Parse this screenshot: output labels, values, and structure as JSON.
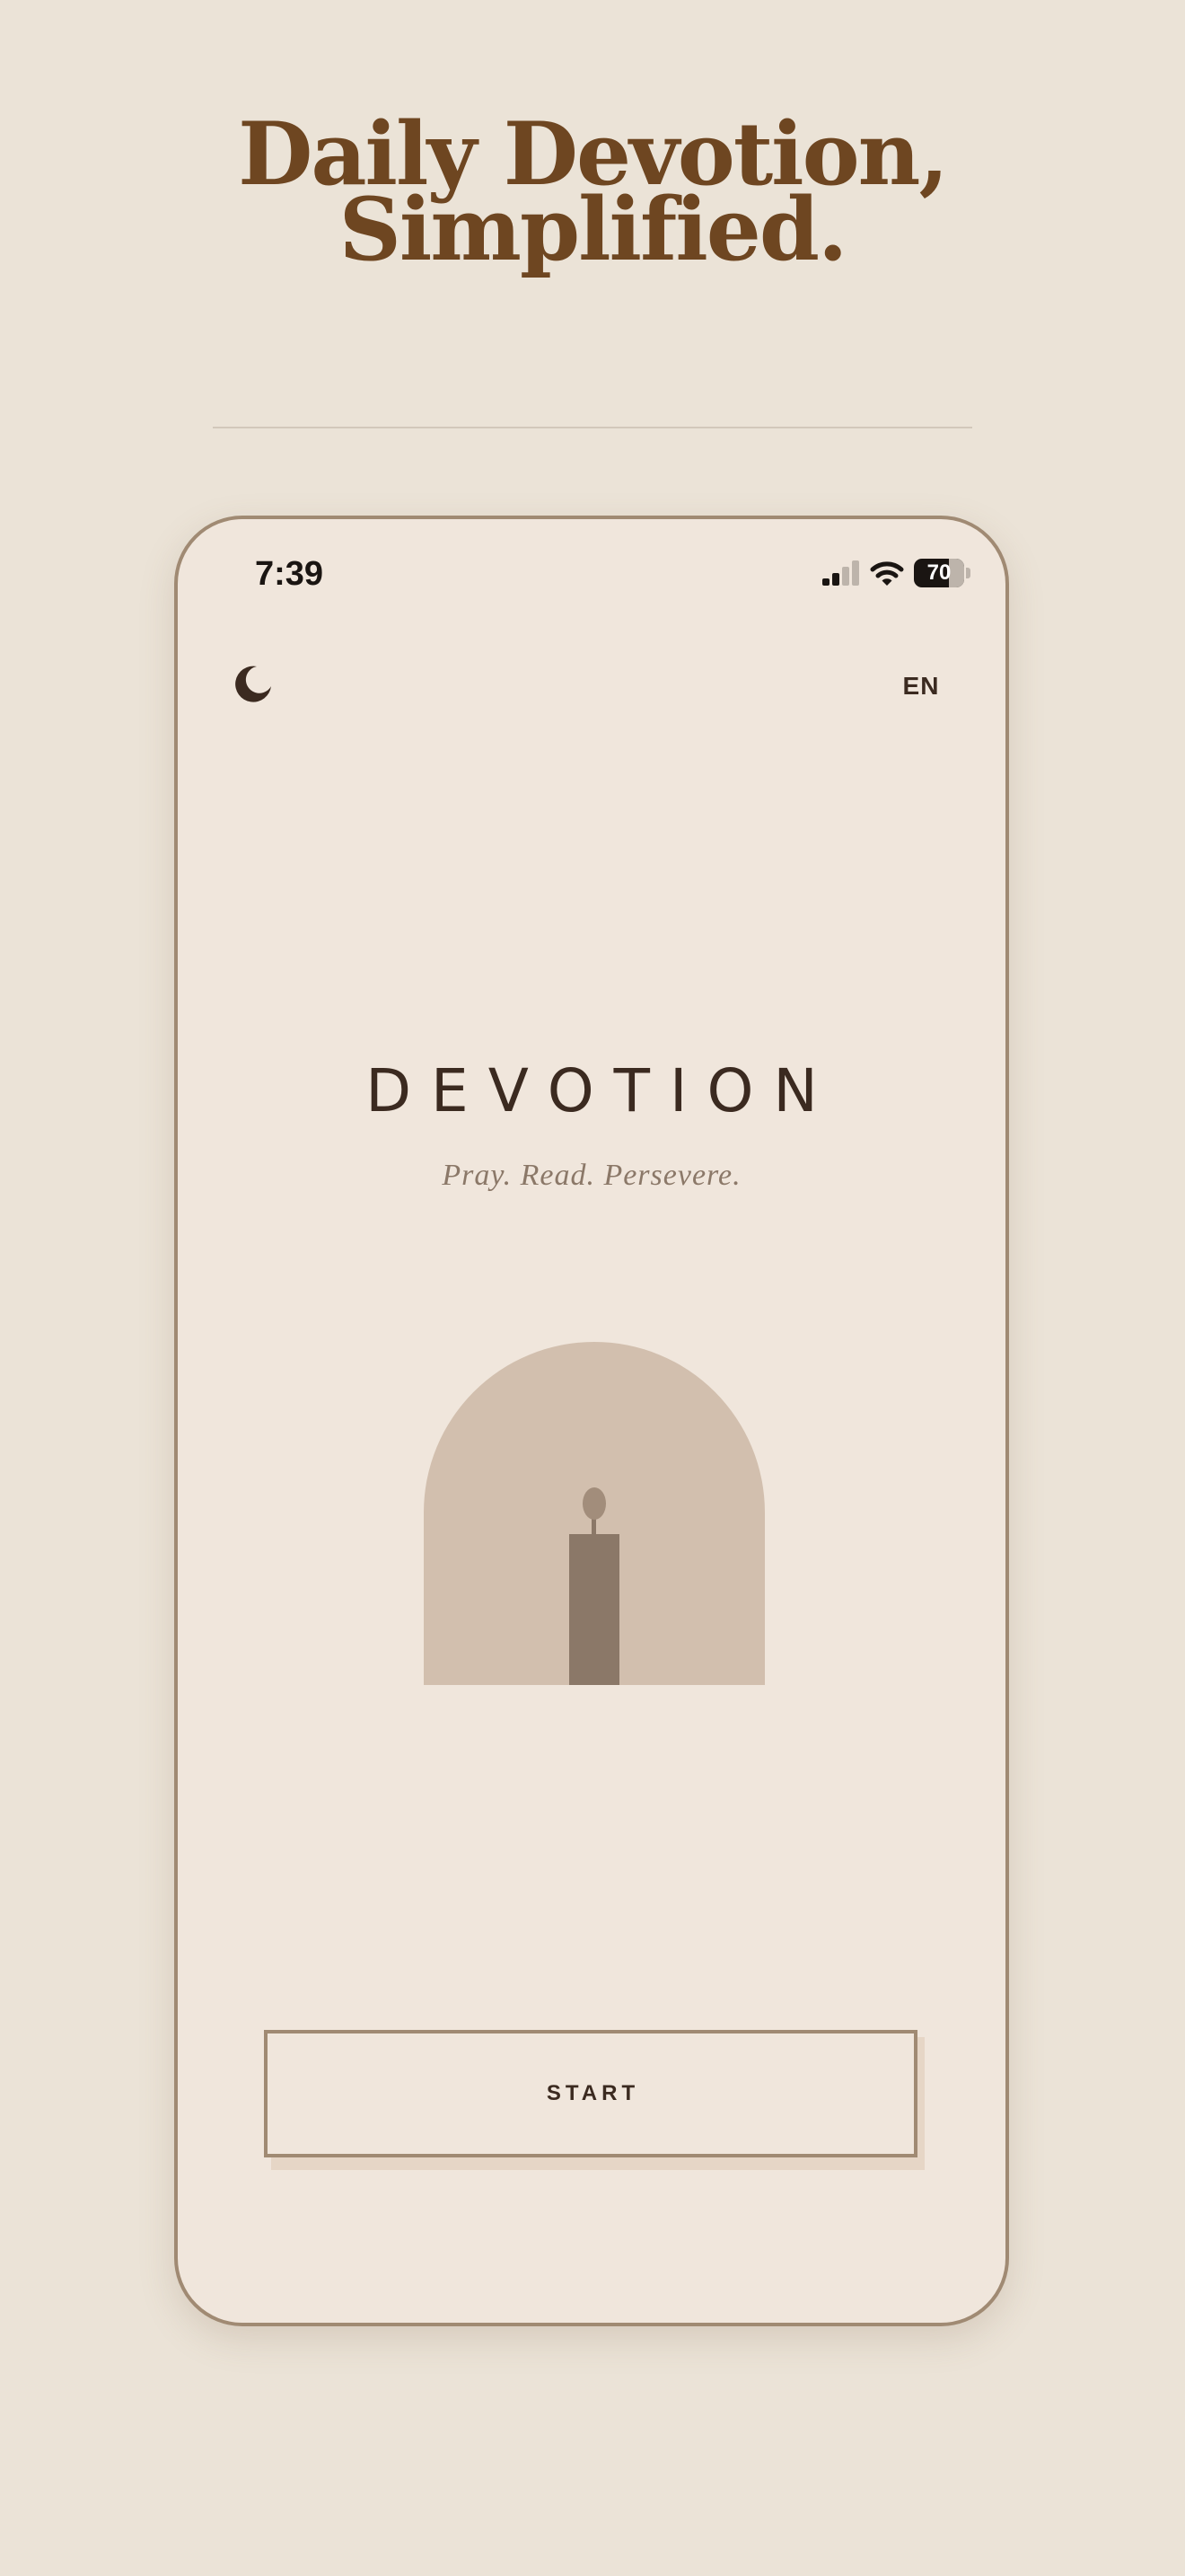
{
  "headline": {
    "line1": "Daily Devotion,",
    "line2": "Simplified."
  },
  "status_bar": {
    "time": "7:39",
    "battery_level": "70",
    "battery_fraction": 0.7,
    "signal_bars_active": 2,
    "signal_bars_total": 4
  },
  "header": {
    "theme_icon": "crescent-moon-icon",
    "language": "EN"
  },
  "main": {
    "title": "DEVOTION",
    "tagline": "Pray. Read. Persevere."
  },
  "illustration": {
    "name": "arch-with-candle",
    "arch_color": "#d2bfae",
    "candle_color": "#8b7868"
  },
  "start_button": {
    "label": "START"
  },
  "colors": {
    "page_background": "#ebe3d7",
    "screen_background": "#f0e6dc",
    "headline": "#6e4621",
    "text_dark": "#3b2a20",
    "accent_border": "#a08a73"
  }
}
